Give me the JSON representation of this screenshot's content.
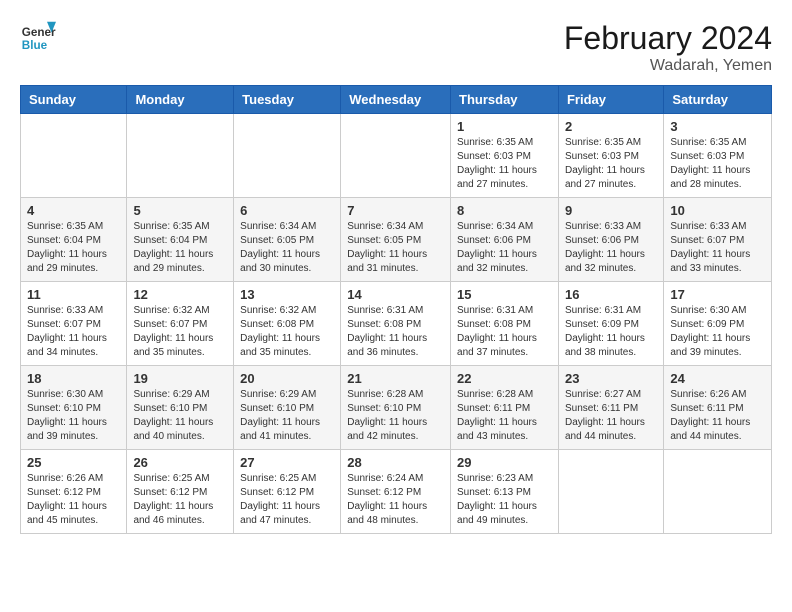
{
  "header": {
    "logo_text_general": "General",
    "logo_text_blue": "Blue",
    "month_title": "February 2024",
    "location": "Wadarah, Yemen"
  },
  "weekdays": [
    "Sunday",
    "Monday",
    "Tuesday",
    "Wednesday",
    "Thursday",
    "Friday",
    "Saturday"
  ],
  "weeks": [
    [
      {
        "day": "",
        "info": ""
      },
      {
        "day": "",
        "info": ""
      },
      {
        "day": "",
        "info": ""
      },
      {
        "day": "",
        "info": ""
      },
      {
        "day": "1",
        "info": "Sunrise: 6:35 AM\nSunset: 6:03 PM\nDaylight: 11 hours\nand 27 minutes."
      },
      {
        "day": "2",
        "info": "Sunrise: 6:35 AM\nSunset: 6:03 PM\nDaylight: 11 hours\nand 27 minutes."
      },
      {
        "day": "3",
        "info": "Sunrise: 6:35 AM\nSunset: 6:03 PM\nDaylight: 11 hours\nand 28 minutes."
      }
    ],
    [
      {
        "day": "4",
        "info": "Sunrise: 6:35 AM\nSunset: 6:04 PM\nDaylight: 11 hours\nand 29 minutes."
      },
      {
        "day": "5",
        "info": "Sunrise: 6:35 AM\nSunset: 6:04 PM\nDaylight: 11 hours\nand 29 minutes."
      },
      {
        "day": "6",
        "info": "Sunrise: 6:34 AM\nSunset: 6:05 PM\nDaylight: 11 hours\nand 30 minutes."
      },
      {
        "day": "7",
        "info": "Sunrise: 6:34 AM\nSunset: 6:05 PM\nDaylight: 11 hours\nand 31 minutes."
      },
      {
        "day": "8",
        "info": "Sunrise: 6:34 AM\nSunset: 6:06 PM\nDaylight: 11 hours\nand 32 minutes."
      },
      {
        "day": "9",
        "info": "Sunrise: 6:33 AM\nSunset: 6:06 PM\nDaylight: 11 hours\nand 32 minutes."
      },
      {
        "day": "10",
        "info": "Sunrise: 6:33 AM\nSunset: 6:07 PM\nDaylight: 11 hours\nand 33 minutes."
      }
    ],
    [
      {
        "day": "11",
        "info": "Sunrise: 6:33 AM\nSunset: 6:07 PM\nDaylight: 11 hours\nand 34 minutes."
      },
      {
        "day": "12",
        "info": "Sunrise: 6:32 AM\nSunset: 6:07 PM\nDaylight: 11 hours\nand 35 minutes."
      },
      {
        "day": "13",
        "info": "Sunrise: 6:32 AM\nSunset: 6:08 PM\nDaylight: 11 hours\nand 35 minutes."
      },
      {
        "day": "14",
        "info": "Sunrise: 6:31 AM\nSunset: 6:08 PM\nDaylight: 11 hours\nand 36 minutes."
      },
      {
        "day": "15",
        "info": "Sunrise: 6:31 AM\nSunset: 6:08 PM\nDaylight: 11 hours\nand 37 minutes."
      },
      {
        "day": "16",
        "info": "Sunrise: 6:31 AM\nSunset: 6:09 PM\nDaylight: 11 hours\nand 38 minutes."
      },
      {
        "day": "17",
        "info": "Sunrise: 6:30 AM\nSunset: 6:09 PM\nDaylight: 11 hours\nand 39 minutes."
      }
    ],
    [
      {
        "day": "18",
        "info": "Sunrise: 6:30 AM\nSunset: 6:10 PM\nDaylight: 11 hours\nand 39 minutes."
      },
      {
        "day": "19",
        "info": "Sunrise: 6:29 AM\nSunset: 6:10 PM\nDaylight: 11 hours\nand 40 minutes."
      },
      {
        "day": "20",
        "info": "Sunrise: 6:29 AM\nSunset: 6:10 PM\nDaylight: 11 hours\nand 41 minutes."
      },
      {
        "day": "21",
        "info": "Sunrise: 6:28 AM\nSunset: 6:10 PM\nDaylight: 11 hours\nand 42 minutes."
      },
      {
        "day": "22",
        "info": "Sunrise: 6:28 AM\nSunset: 6:11 PM\nDaylight: 11 hours\nand 43 minutes."
      },
      {
        "day": "23",
        "info": "Sunrise: 6:27 AM\nSunset: 6:11 PM\nDaylight: 11 hours\nand 44 minutes."
      },
      {
        "day": "24",
        "info": "Sunrise: 6:26 AM\nSunset: 6:11 PM\nDaylight: 11 hours\nand 44 minutes."
      }
    ],
    [
      {
        "day": "25",
        "info": "Sunrise: 6:26 AM\nSunset: 6:12 PM\nDaylight: 11 hours\nand 45 minutes."
      },
      {
        "day": "26",
        "info": "Sunrise: 6:25 AM\nSunset: 6:12 PM\nDaylight: 11 hours\nand 46 minutes."
      },
      {
        "day": "27",
        "info": "Sunrise: 6:25 AM\nSunset: 6:12 PM\nDaylight: 11 hours\nand 47 minutes."
      },
      {
        "day": "28",
        "info": "Sunrise: 6:24 AM\nSunset: 6:12 PM\nDaylight: 11 hours\nand 48 minutes."
      },
      {
        "day": "29",
        "info": "Sunrise: 6:23 AM\nSunset: 6:13 PM\nDaylight: 11 hours\nand 49 minutes."
      },
      {
        "day": "",
        "info": ""
      },
      {
        "day": "",
        "info": ""
      }
    ]
  ]
}
